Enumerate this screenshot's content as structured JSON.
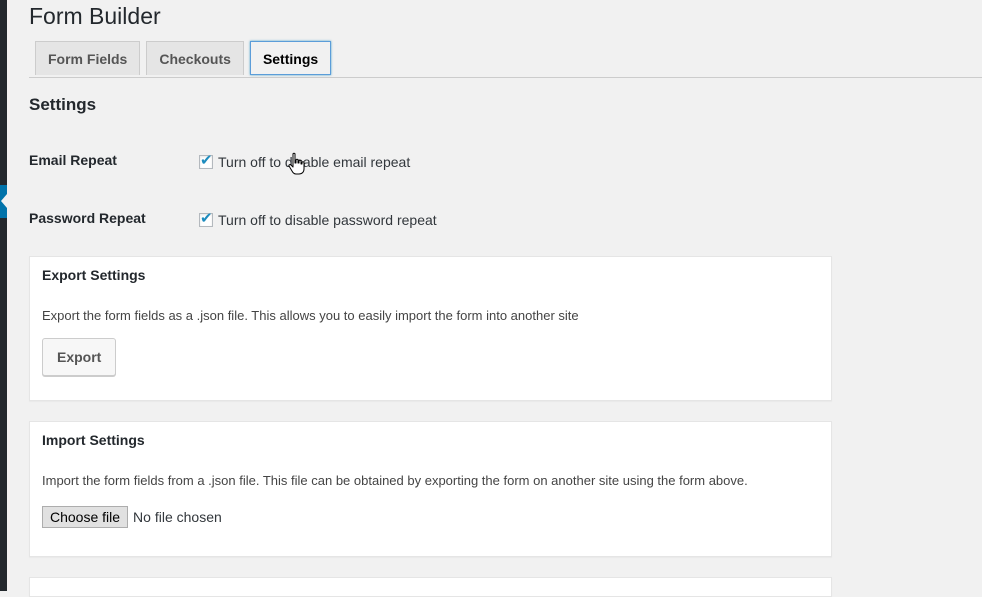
{
  "page": {
    "title": "Form Builder"
  },
  "tabs": [
    {
      "label": "Form Fields",
      "active": false
    },
    {
      "label": "Checkouts",
      "active": false
    },
    {
      "label": "Settings",
      "active": true
    }
  ],
  "section": {
    "title": "Settings"
  },
  "settings": {
    "email_repeat": {
      "label": "Email Repeat",
      "checkbox_text": "Turn off to disable email repeat",
      "checked": true
    },
    "password_repeat": {
      "label": "Password Repeat",
      "checkbox_text": "Turn off to disable password repeat",
      "checked": true
    }
  },
  "export": {
    "title": "Export Settings",
    "description": "Export the form fields as a .json file. This allows you to easily import the form into another site",
    "button_label": "Export"
  },
  "import": {
    "title": "Import Settings",
    "description": "Import the form fields from a .json file. This file can be obtained by exporting the form on another site using the form above.",
    "file_button_label": "Choose file",
    "file_status": "No file chosen"
  },
  "icons": {
    "checkmark": "check-icon",
    "cursor": "hand-pointer-icon"
  },
  "colors": {
    "accent": "#0073aa",
    "check": "#1e8cbe",
    "active_tab_border": "#5b9dd9"
  }
}
